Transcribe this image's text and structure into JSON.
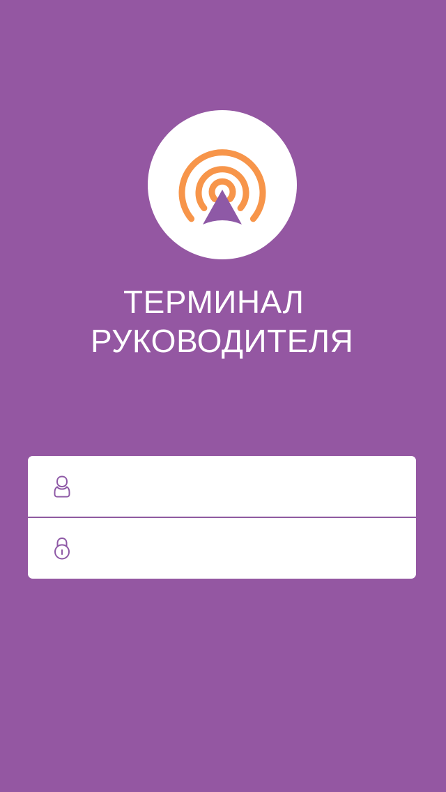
{
  "app": {
    "title_line1": "ТЕРМИНАЛ",
    "title_line2": "РУКОВОДИТЕЛЯ"
  },
  "logo": {
    "icon": "signal-broadcast-logo",
    "arc_color": "#f7954a",
    "arrow_color": "#8e59a6"
  },
  "login": {
    "username": {
      "icon": "user-icon",
      "value": "",
      "placeholder": ""
    },
    "password": {
      "icon": "lock-icon",
      "value": "",
      "placeholder": ""
    }
  },
  "colors": {
    "background": "#9457a2",
    "form_background": "#ffffff",
    "divider": "#8f5aa0"
  }
}
